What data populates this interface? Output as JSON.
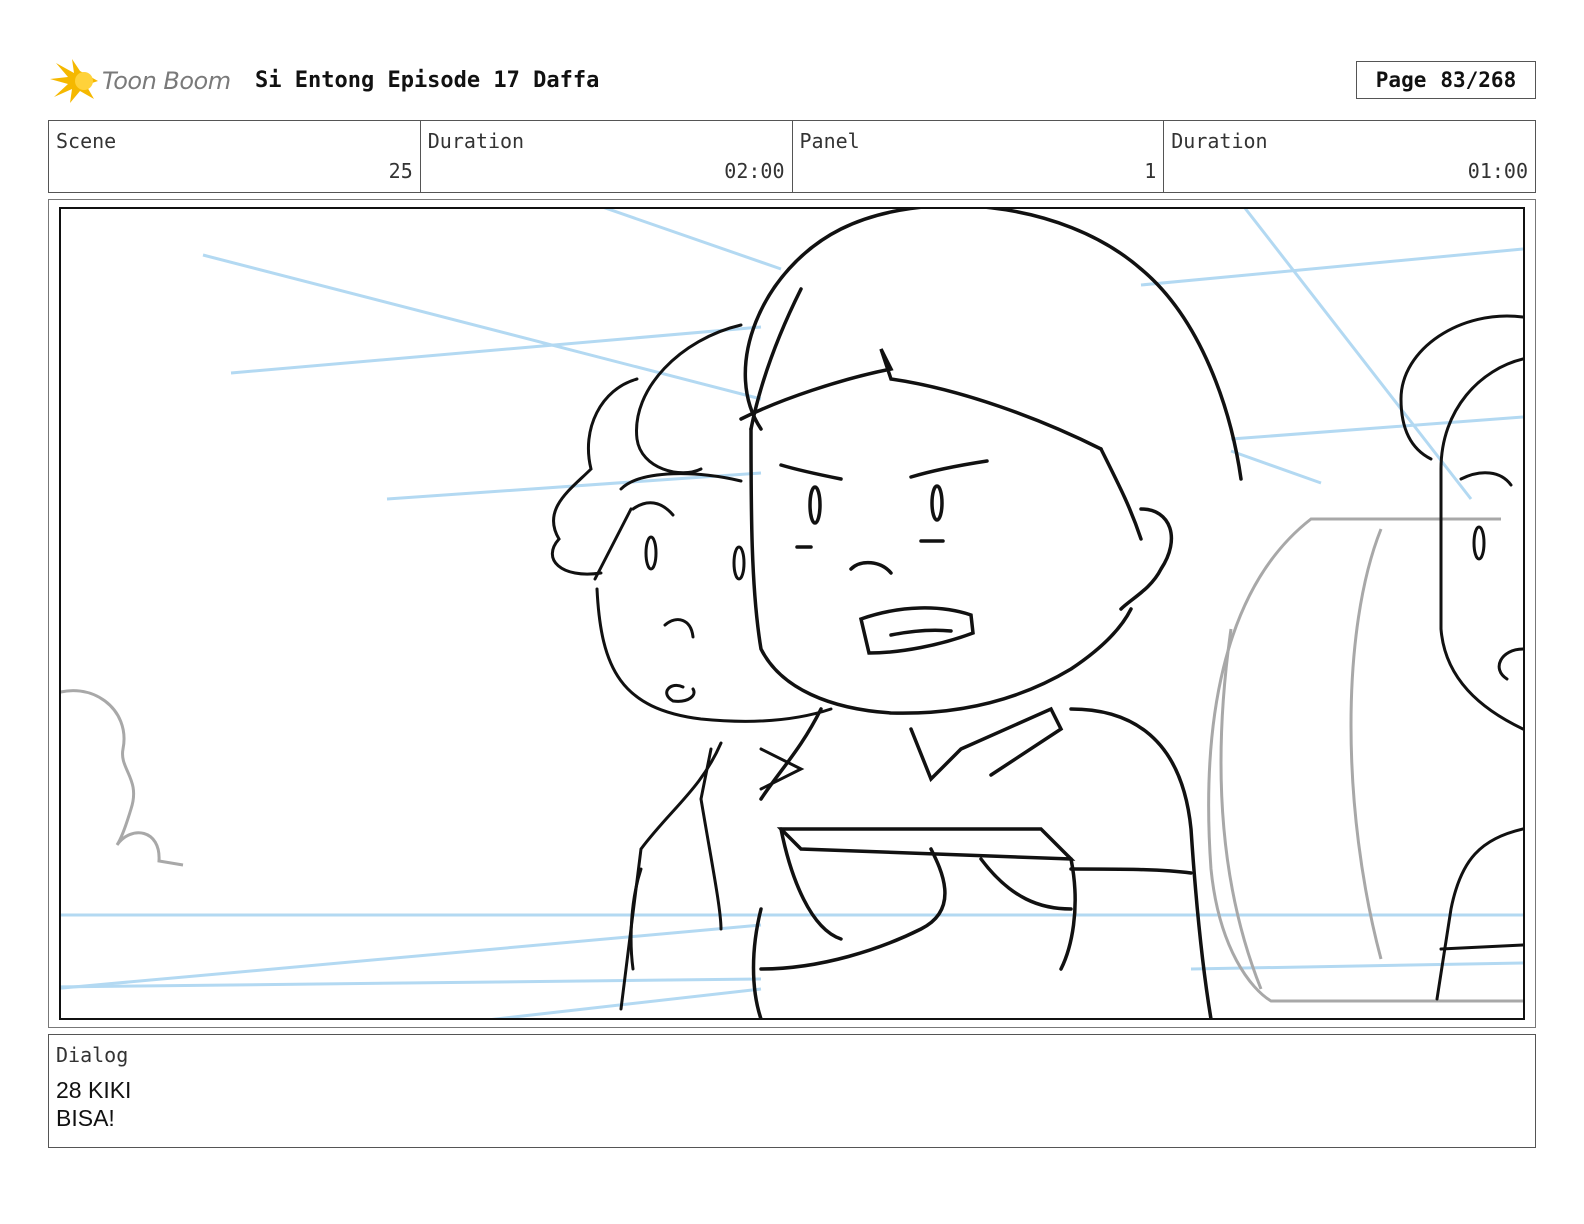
{
  "header": {
    "logo_text": "Toon Boom",
    "title": "Si Entong Episode 17 Daffa",
    "page_label": "Page",
    "page_value": "83/268"
  },
  "info": {
    "scene_label": "Scene",
    "scene_value": "25",
    "duration_label": "Duration",
    "duration_value": "02:00",
    "panel_label": "Panel",
    "panel_value": "1",
    "panel_duration_label": "Duration",
    "panel_duration_value": "01:00"
  },
  "dialog": {
    "label": "Dialog",
    "line1": "28 KIKI",
    "line2": "BISA!"
  },
  "colors": {
    "logo_star": "#f5b800",
    "guide_lines": "#b3d9f2",
    "sketch": "#111111",
    "rough": "#a8a8a8"
  }
}
